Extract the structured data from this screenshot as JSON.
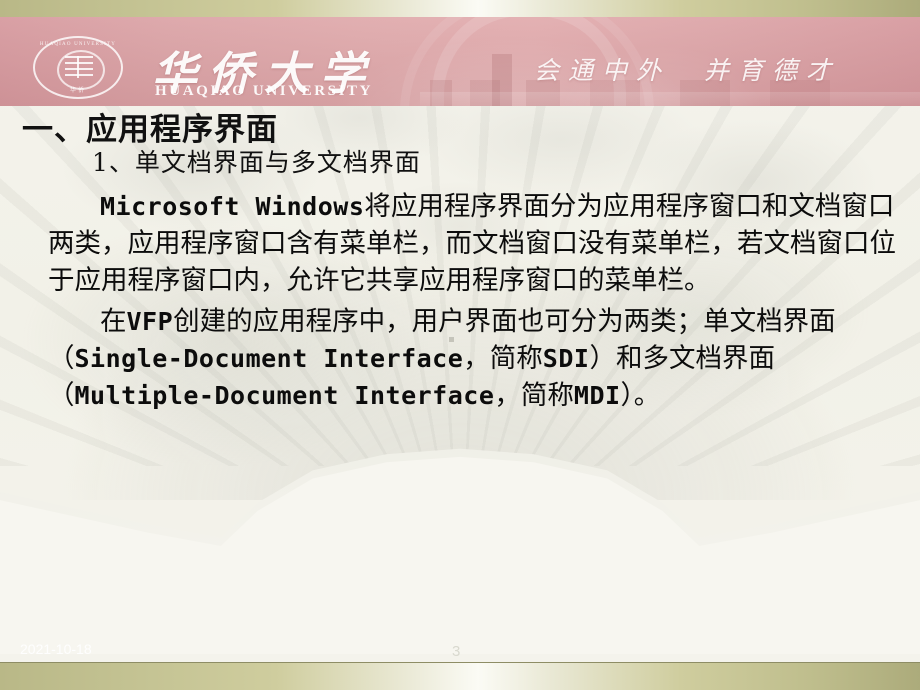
{
  "slide": {
    "header": {
      "logo_seal_top": "HUAQIAO UNIVERSITY",
      "logo_seal_bottom": "华侨",
      "university_name_cn": "华侨大学",
      "university_name_en": "HUAQIAO UNIVERSITY",
      "motto": "会通中外　并育德才"
    },
    "title": "一、应用程序界面",
    "subtitle": "1、单文档界面与多文档界面",
    "paragraphs": [
      {
        "runs": [
          {
            "text": "Microsoft Windows",
            "style": "mono"
          },
          {
            "text": "将应用程序界面分为应用程序窗口和文档窗口两类，应用程序窗口含有菜单栏，而文档窗口没有菜单栏，若文档窗口位于应用程序窗口内，允许它共享应用程序窗口的菜单栏。",
            "style": "cjk"
          }
        ]
      },
      {
        "runs": [
          {
            "text": "在",
            "style": "cjk"
          },
          {
            "text": "VFP",
            "style": "mono"
          },
          {
            "text": "创建的应用程序中，用户界面也可分为两类；单文档界面（",
            "style": "cjk"
          },
          {
            "text": "Single-Document Interface",
            "style": "mono"
          },
          {
            "text": "，简称",
            "style": "cjk"
          },
          {
            "text": "SDI",
            "style": "mono"
          },
          {
            "text": "）和多文档界面（",
            "style": "cjk"
          },
          {
            "text": "Multiple-Document Interface",
            "style": "mono"
          },
          {
            "text": "，简称",
            "style": "cjk"
          },
          {
            "text": "MDI",
            "style": "mono"
          },
          {
            "text": "）。",
            "style": "cjk"
          }
        ]
      }
    ],
    "footer": {
      "date": "2021-10-18",
      "page_number": "3"
    },
    "colors": {
      "banner_pink": "#e0abad",
      "bar_olive": "#bfbe8d",
      "background_cream": "#f3f2ea",
      "text_black": "#0c0c0c"
    }
  }
}
